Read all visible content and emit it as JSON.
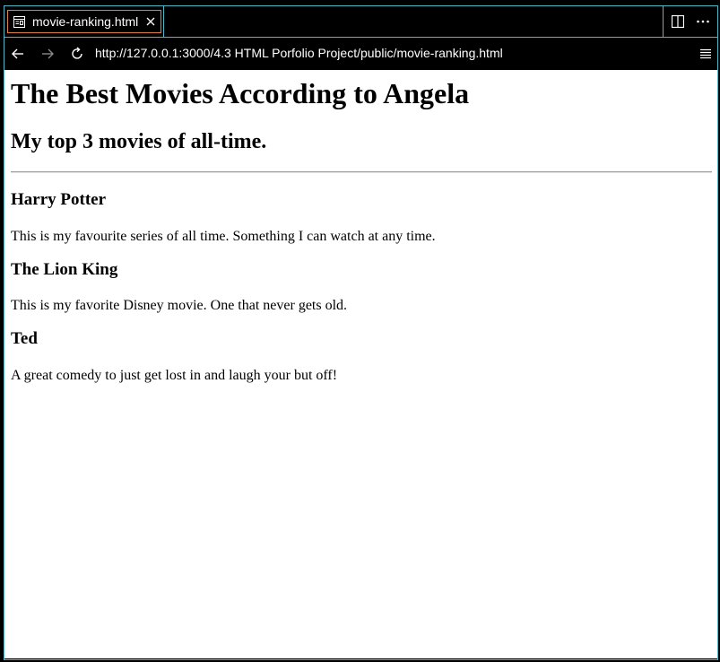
{
  "tab": {
    "label": "movie-ranking.html",
    "icon": "preview-icon",
    "close_icon": "close-icon"
  },
  "toolbar": {
    "split_icon": "split-editor-icon",
    "more_icon": "more-actions-icon"
  },
  "nav": {
    "back_icon": "back-arrow-icon",
    "forward_icon": "forward-arrow-icon",
    "reload_icon": "reload-icon",
    "url": "http://127.0.0.1:3000/4.3 HTML Porfolio Project/public/movie-ranking.html",
    "menu_icon": "menu-icon"
  },
  "page": {
    "title": "The Best Movies According to Angela",
    "subtitle": "My top 3 movies of all-time.",
    "movies": [
      {
        "title": "Harry Potter",
        "description": "This is my favourite series of all time. Something I can watch at any time."
      },
      {
        "title": "The Lion King",
        "description": "This is my favorite Disney movie. One that never gets old."
      },
      {
        "title": "Ted",
        "description": "A great comedy to just get lost in and laugh your but off!"
      }
    ]
  },
  "colors": {
    "chrome_background": "#000000",
    "frame_border": "#4cb8c8",
    "active_tab_border": "#d9824a",
    "page_background": "#ffffff"
  }
}
